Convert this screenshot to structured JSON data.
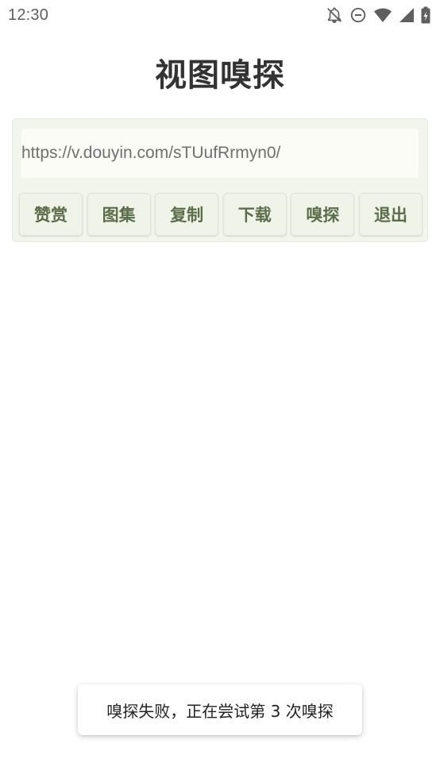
{
  "status_bar": {
    "time": "12:30",
    "icons": [
      "notifications-off-icon",
      "do-not-disturb-icon",
      "wifi-icon",
      "cellular-signal-icon",
      "battery-charging-icon"
    ]
  },
  "header": {
    "title": "视图嗅探"
  },
  "url_field": {
    "value": "https://v.douyin.com/sTUufRrmyn0/"
  },
  "actions": {
    "reward": "赞赏",
    "gallery": "图集",
    "copy": "复制",
    "download": "下载",
    "sniff": "嗅探",
    "exit": "退出"
  },
  "toast": {
    "message": "嗅探失败，正在尝试第 3 次嗅探"
  },
  "colors": {
    "accent_text": "#5a6e48",
    "card_bg": "#f2f5ec",
    "title": "#333333"
  }
}
